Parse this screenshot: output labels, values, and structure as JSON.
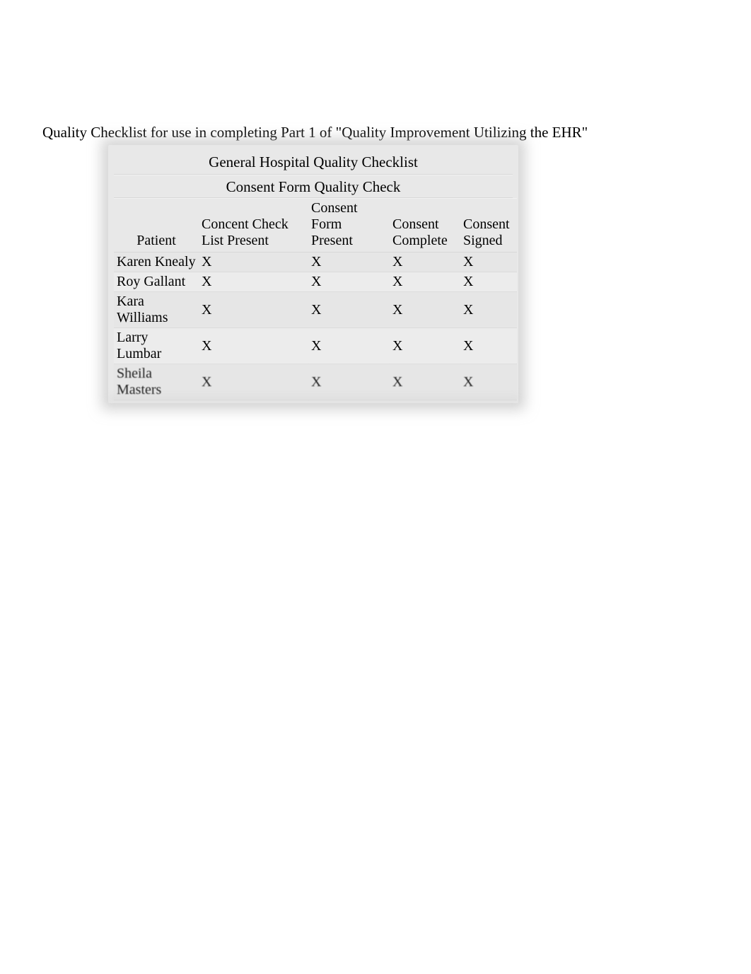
{
  "page": {
    "heading": "Quality Checklist for use in completing Part 1 of \"Quality Improvement Utilizing the EHR\""
  },
  "table": {
    "title": "General Hospital Quality Checklist",
    "subtitle": "Consent Form Quality Check",
    "headers": {
      "patient": "Patient",
      "check_list_present": "Concent Check List Present",
      "form_present": "Consent Form Present",
      "complete": "Consent Complete",
      "signed": "Consent Signed"
    },
    "rows": [
      {
        "patient": "Karen Knealy",
        "check_list_present": "X",
        "form_present": "X",
        "complete": "X",
        "signed": "X"
      },
      {
        "patient": "Roy Gallant",
        "check_list_present": "X",
        "form_present": "X",
        "complete": "X",
        "signed": "X"
      },
      {
        "patient": "Kara Williams",
        "check_list_present": "X",
        "form_present": "X",
        "complete": "X",
        "signed": "X"
      },
      {
        "patient": "Larry Lumbar",
        "check_list_present": "X",
        "form_present": "X",
        "complete": "X",
        "signed": "X"
      },
      {
        "patient": "Sheila Masters",
        "check_list_present": "X",
        "form_present": "X",
        "complete": "X",
        "signed": "X"
      }
    ]
  }
}
